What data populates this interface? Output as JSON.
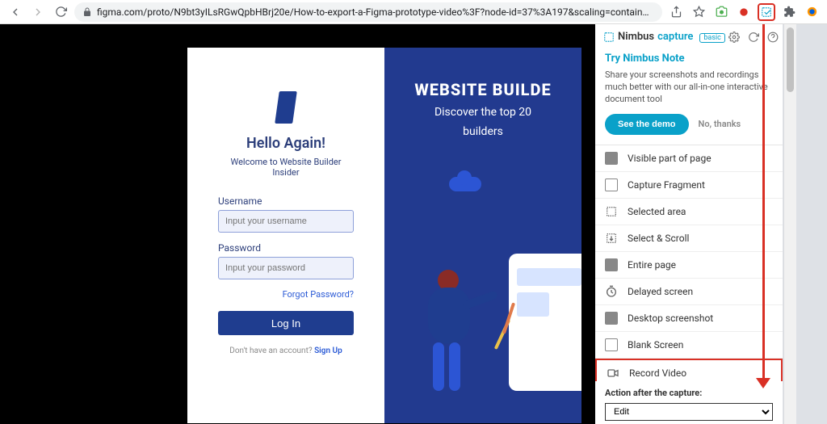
{
  "browser": {
    "url": "figma.com/proto/N9bt3yILsRGwQpbHBrj20e/How-to-export-a-Figma-prototype-video%3F?node-id=37%3A197&scaling=contain&page-id=..."
  },
  "proto": {
    "hello": "Hello Again!",
    "welcome": "Welcome to Website Builder Insider",
    "username_label": "Username",
    "username_placeholder": "Input your username",
    "password_label": "Password",
    "password_placeholder": "Input your password",
    "forgot": "Forgot Password?",
    "login": "Log In",
    "noacct": "Don't have an account? ",
    "signup": "Sign Up",
    "wb_title": "WEBSITE BUILDE",
    "wb_sub1": "Discover the top 20",
    "wb_sub2": "builders"
  },
  "panel": {
    "brand_n": "Nimbus",
    "brand_c": "capture",
    "basic": "basic",
    "promo_title": "Try Nimbus Note",
    "promo_text": "Share your screenshots and recordings much better with our all-in-one interactive document tool",
    "demo": "See the demo",
    "nothanks": "No, thanks",
    "options": [
      "Visible part of page",
      "Capture Fragment",
      "Selected area",
      "Select & Scroll",
      "Entire page",
      "Delayed screen",
      "Desktop screenshot",
      "Blank Screen",
      "Record Video"
    ],
    "after_label": "Action after the capture:",
    "after_selected": "Edit"
  }
}
